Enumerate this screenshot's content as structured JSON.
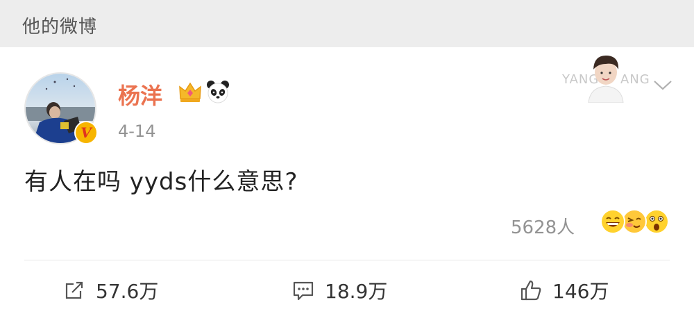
{
  "header": {
    "title": "他的微博"
  },
  "post": {
    "author": {
      "name": "杨洋",
      "verified_badge": "V"
    },
    "date": "4-14",
    "text": "有人在吗 yyds什么意思?",
    "card_text_left": "YANG",
    "card_text_right": "ANG",
    "reactions": {
      "count_label": "5628人",
      "emojis": [
        "laughing-emoji",
        "wink-emoji",
        "surprised-emoji"
      ]
    },
    "actions": {
      "repost_count": "57.6万",
      "comment_count": "18.9万",
      "like_count": "146万"
    }
  },
  "colors": {
    "username": "#eb7350",
    "header_bg": "#ededed",
    "meta_gray": "#939393"
  }
}
